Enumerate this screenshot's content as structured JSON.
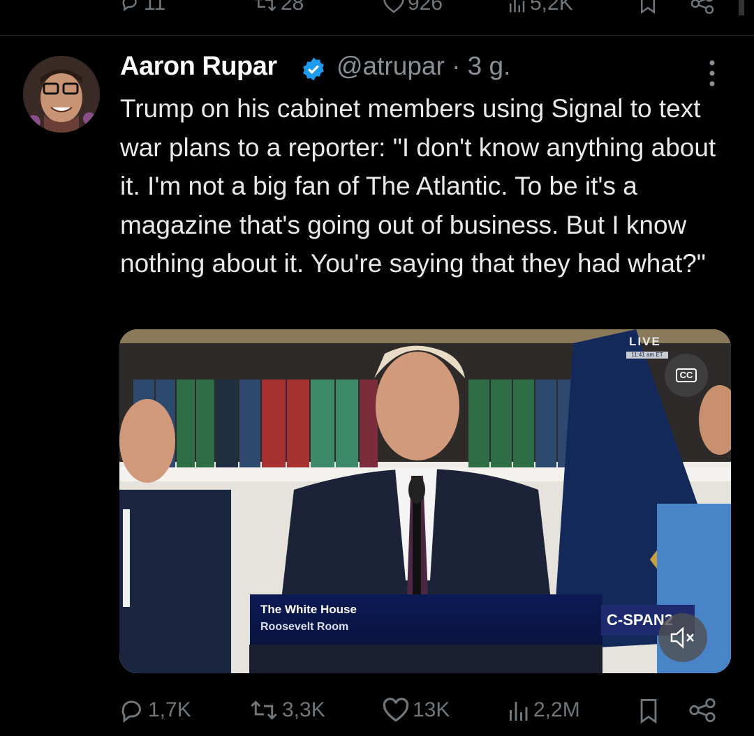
{
  "prev_tweet": {
    "replies": "11",
    "reposts": "28",
    "likes": "926",
    "views": "5,2K"
  },
  "tweet": {
    "author_name": "Aaron Rupar",
    "handle_time": "@atrupar · 3 g.",
    "text": "Trump on his cabinet members using Signal to text war plans to a reporter: \"I don't know anything about it. I'm not a big fan of The Atlantic. To be it's a magazine that's going out of business. But I know nothing about it. You're saying that they had what?\"",
    "video": {
      "live_label": "LIVE",
      "live_time": "11:41 am ET",
      "cc_label": "CC",
      "lower_third_line1": "The White House",
      "lower_third_line2": "Roosevelt Room",
      "network_logo": "C-SPAN2"
    },
    "stats": {
      "replies": "1,7K",
      "reposts": "3,3K",
      "likes": "13K",
      "views": "2,2M"
    }
  },
  "icons": {
    "reply": "speech-bubble-icon",
    "repost": "repost-arrows-icon",
    "like": "heart-icon",
    "views": "bar-chart-icon",
    "bookmark": "bookmark-icon",
    "share": "share-icon",
    "verified": "verified-badge-icon",
    "more": "vertical-ellipsis-icon",
    "mute": "speaker-muted-icon"
  },
  "colors": {
    "background": "#000000",
    "text": "#e7e9ea",
    "secondary": "#71767b",
    "verified": "#1d9bf0"
  }
}
